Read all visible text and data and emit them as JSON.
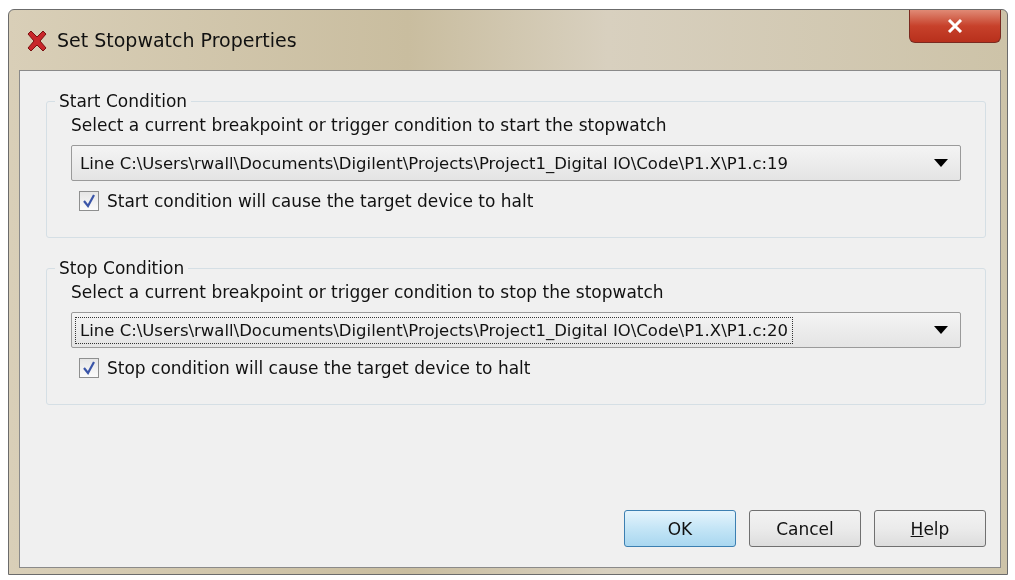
{
  "window": {
    "title": "Set Stopwatch Properties"
  },
  "groups": [
    {
      "title": "Start Condition",
      "prompt": "Select a current breakpoint or trigger condition to start the stopwatch",
      "dropdown": {
        "value": "Line C:\\Users\\rwall\\Documents\\Digilent\\Projects\\Project1_Digital IO\\Code\\P1.X\\P1.c:19",
        "focused": false
      },
      "checkbox": {
        "label": "Start condition will cause the target device to halt",
        "checked": true
      }
    },
    {
      "title": "Stop Condition",
      "prompt": "Select a current breakpoint or trigger condition to stop the stopwatch",
      "dropdown": {
        "value": "Line C:\\Users\\rwall\\Documents\\Digilent\\Projects\\Project1_Digital IO\\Code\\P1.X\\P1.c:20",
        "focused": true
      },
      "checkbox": {
        "label": "Stop condition will cause the target device to halt",
        "checked": true
      }
    }
  ],
  "buttons": [
    {
      "label": "OK",
      "default": true,
      "mnemonic": false
    },
    {
      "label": "Cancel",
      "default": false,
      "mnemonic": false
    },
    {
      "label": "Help",
      "default": false,
      "mnemonic": true
    }
  ]
}
